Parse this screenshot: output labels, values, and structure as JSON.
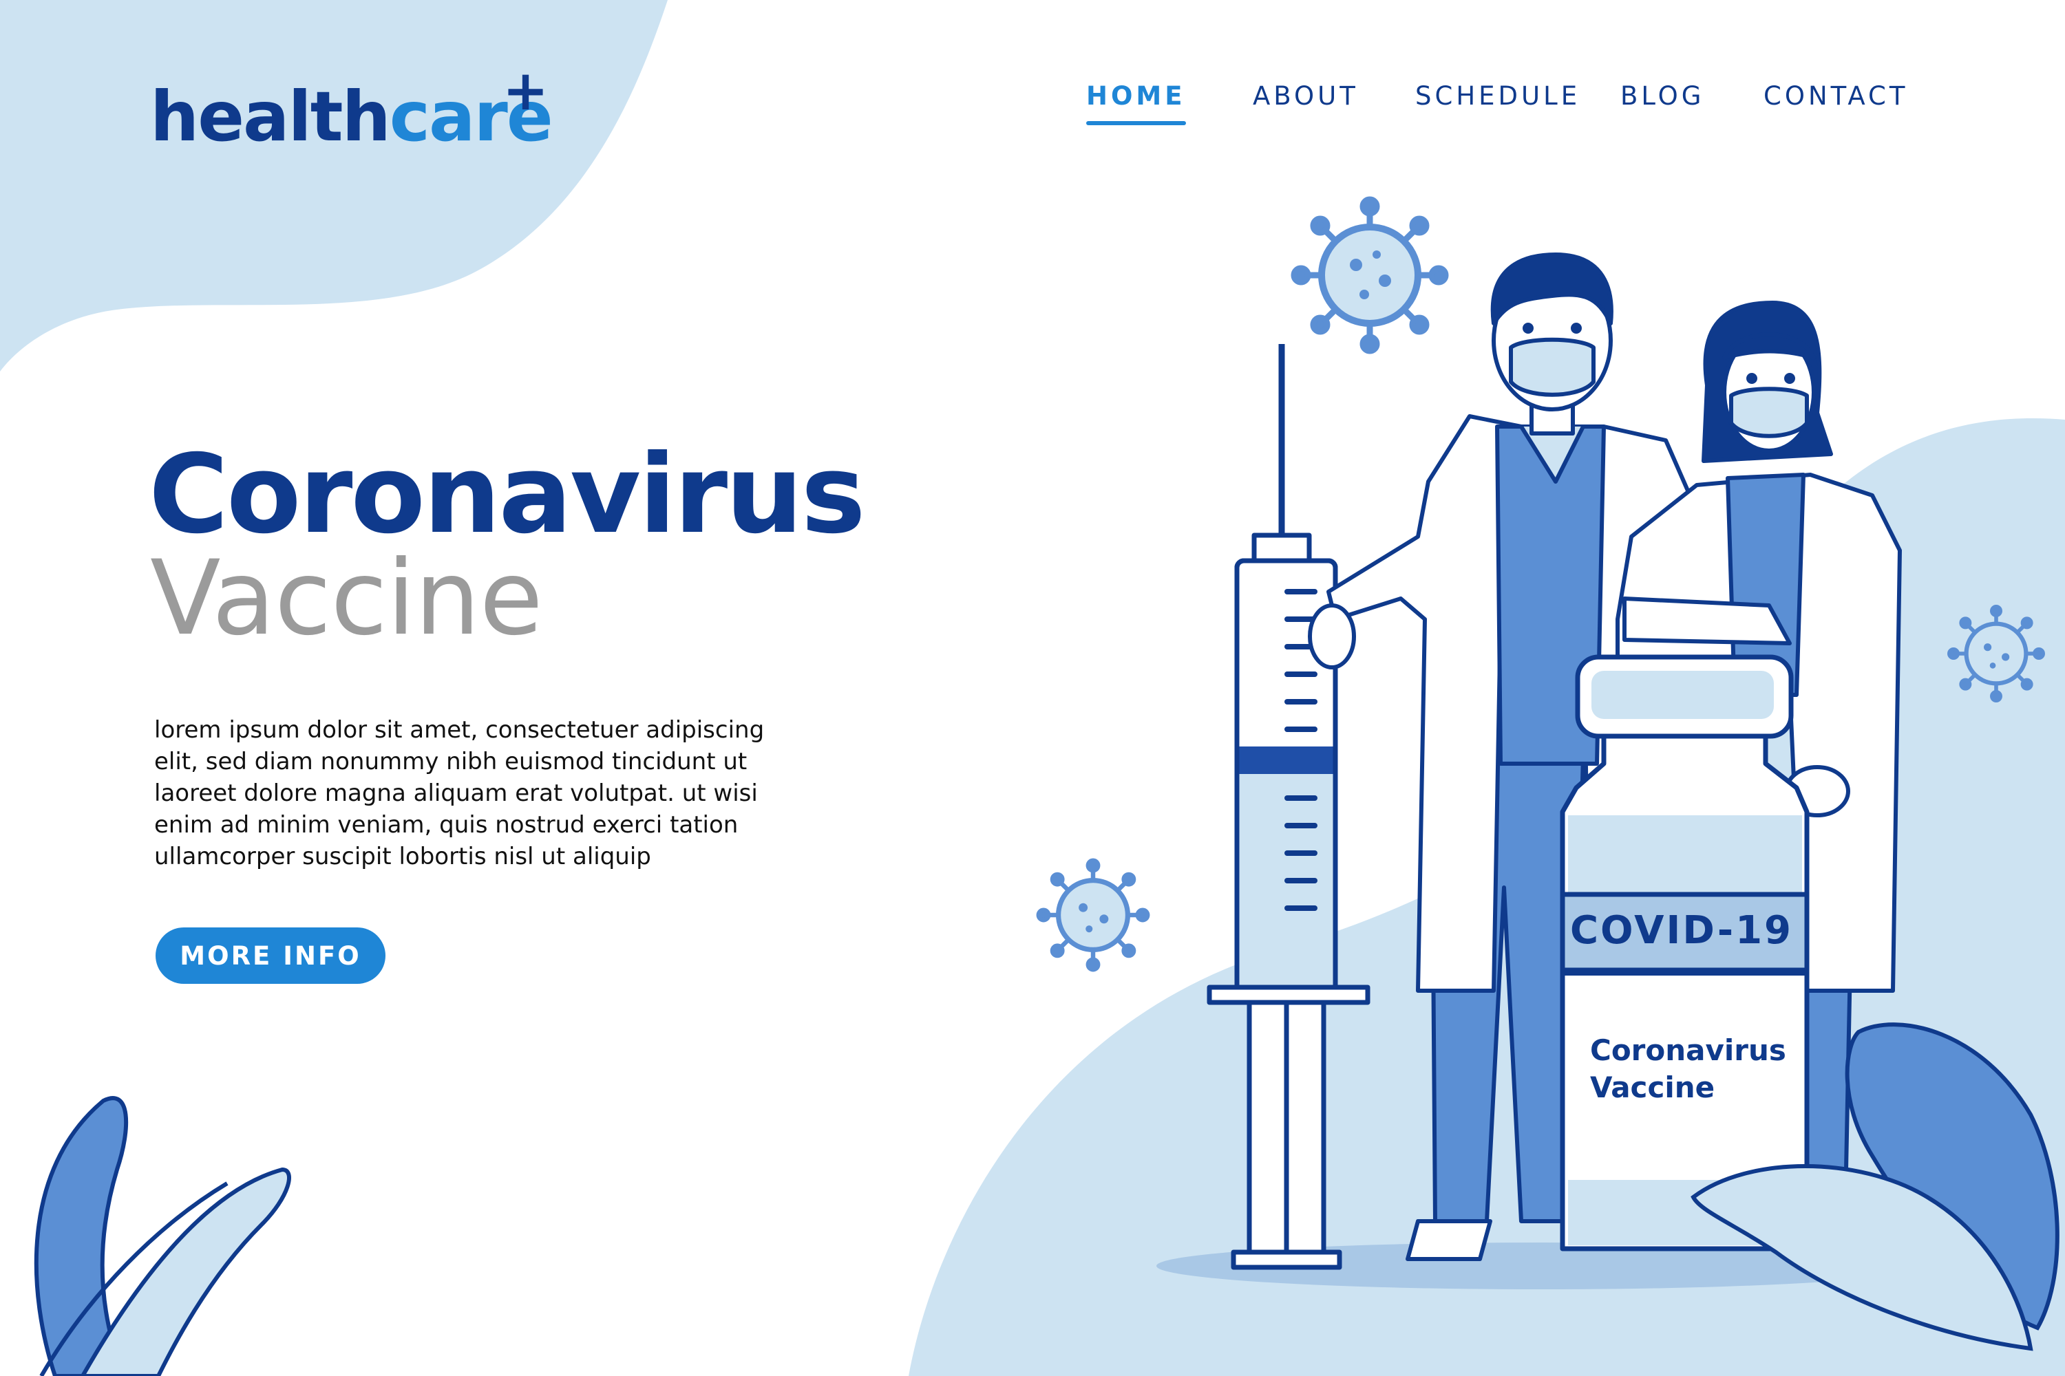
{
  "brand": {
    "part1": "health",
    "part2": "care",
    "plus": "+"
  },
  "nav": {
    "items": [
      {
        "label": "HOME",
        "active": true
      },
      {
        "label": "ABOUT",
        "active": false
      },
      {
        "label": "SCHEDULE",
        "active": false
      },
      {
        "label": "BLOG",
        "active": false
      },
      {
        "label": "CONTACT",
        "active": false
      }
    ]
  },
  "hero": {
    "title_line1": "Coronavirus",
    "title_line2": "Vaccine",
    "body_lines": [
      "lorem ipsum dolor sit amet, consectetuer adipiscing",
      "elit, sed diam nonummy nibh euismod tincidunt ut",
      "laoreet dolore magna aliquam erat volutpat. ut wisi",
      "enim ad minim veniam, quis nostrud exerci tation",
      "ullamcorper suscipit lobortis nisl ut aliquip"
    ],
    "cta_label": "MORE INFO"
  },
  "illustration": {
    "vial_band": "COVID-19",
    "vial_label_line1": "Coronavirus",
    "vial_label_line2": "Vaccine"
  },
  "colors": {
    "primary_dark": "#0f3a8c",
    "primary": "#1f86d6",
    "light_blue": "#cde3f2",
    "mid_blue": "#5b8fd4",
    "gray_text": "#9b9b9b"
  }
}
